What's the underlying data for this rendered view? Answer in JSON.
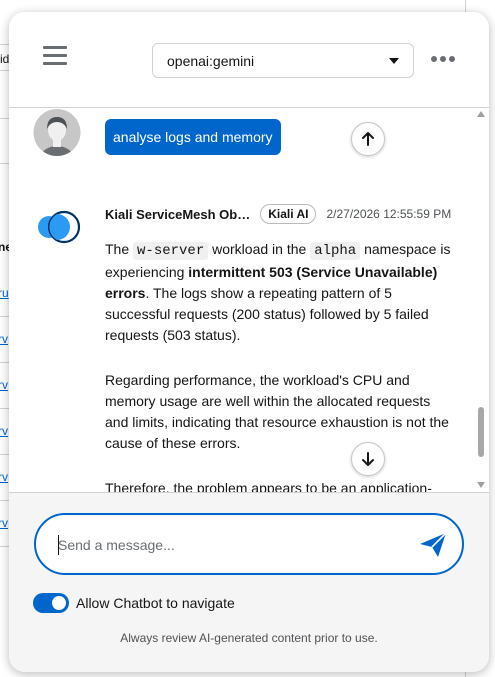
{
  "background": {
    "fragments": [
      "id",
      "ne",
      "ru",
      "rv",
      "rv",
      "rv",
      "rv",
      "rv"
    ]
  },
  "header": {
    "menu_icon": "hamburger-icon",
    "model_value": "openai:gemini",
    "more_icon": "ellipsis-icon"
  },
  "user_message": {
    "text": "analyse logs and memory",
    "avatar_icon": "user-avatar-icon"
  },
  "bot_message": {
    "name": "Kiali ServiceMesh Ob…",
    "badge": "Kiali AI",
    "timestamp": "2/27/2026 12:55:59 PM",
    "p1_part1": "The ",
    "p1_code1": "w-server",
    "p1_part2": " workload in the ",
    "p1_code2": "alpha",
    "p1_part3": " namespace is experiencing ",
    "p1_bold": "intermittent 503 (Service Unavailable) errors",
    "p1_part4": ". The logs show a repeating pattern of 5 successful requests (200 status) followed by 5 failed requests (503 status).",
    "p2": "Regarding performance, the workload's CPU and memory usage are well within the allocated requests and limits, indicating that resource exhaustion is not the cause of these errors.",
    "p3": "Therefore, the problem appears to be an application-"
  },
  "composer": {
    "placeholder": "Send a message...",
    "send_icon": "paper-plane-icon"
  },
  "navigate_toggle": {
    "label": "Allow Chatbot to navigate",
    "on": true
  },
  "disclaimer": "Always review AI-generated content prior to use.",
  "colors": {
    "accent": "#0066cc",
    "bot_avatar_light": "#2b9af3",
    "bot_avatar_dark": "#003366"
  }
}
